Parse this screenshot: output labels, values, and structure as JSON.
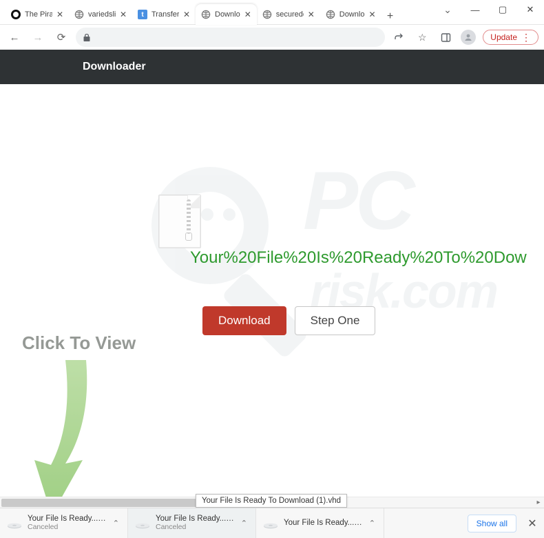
{
  "window": {
    "tabs": [
      {
        "title": "The Pirat"
      },
      {
        "title": "variedsli"
      },
      {
        "title": "Transfer"
      },
      {
        "title": "Downlo"
      },
      {
        "title": "securedo"
      },
      {
        "title": "Downlo"
      }
    ],
    "update_label": "Update"
  },
  "page": {
    "brand": "Downloader",
    "headline": "Your%20File%20Is%20Ready%20To%20Dow",
    "download_btn": "Download",
    "step_btn": "Step One",
    "overlay_text": "Click To View"
  },
  "tooltip": "Your File Is Ready To Download (1).vhd",
  "shelf": {
    "items": [
      {
        "name": "Your File Is Ready....vhd",
        "status": "Canceled"
      },
      {
        "name": "Your File Is Ready....vhd",
        "status": "Canceled"
      },
      {
        "name": "Your File Is Ready....vhd",
        "status": ""
      }
    ],
    "show_all": "Show all"
  }
}
